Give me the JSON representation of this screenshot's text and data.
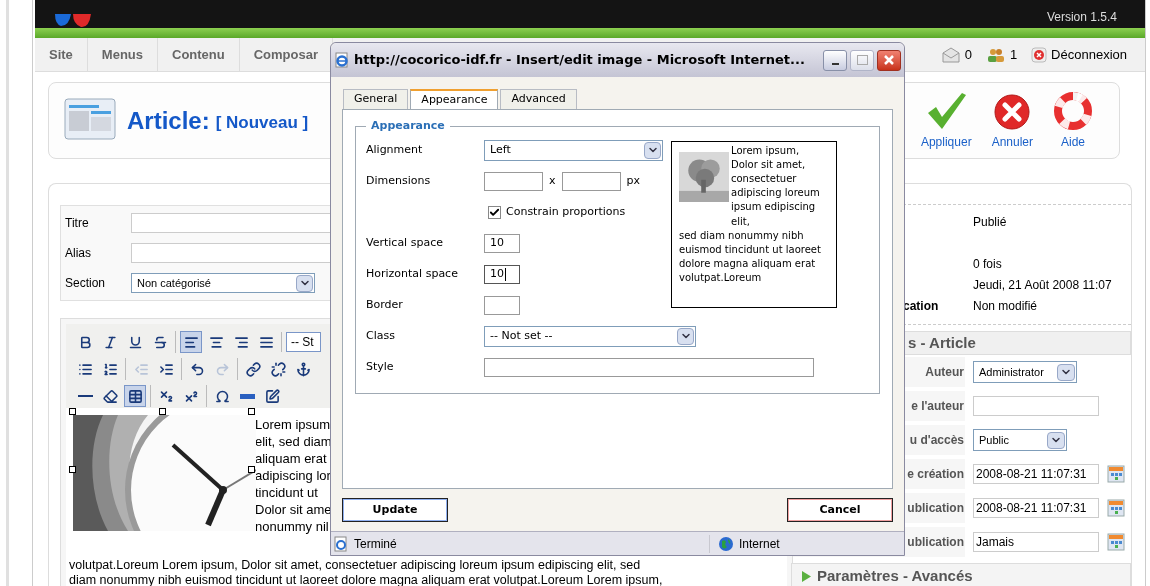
{
  "header": {
    "version": "Version 1.5.4"
  },
  "menu": {
    "items": [
      {
        "label": "Site"
      },
      {
        "label": "Menus"
      },
      {
        "label": "Contenu"
      },
      {
        "label": "Composar"
      }
    ],
    "status": [
      {
        "kind": "messages",
        "label": "0"
      },
      {
        "kind": "users",
        "label": "1"
      },
      {
        "kind": "logout",
        "label": "Déconnexion"
      }
    ]
  },
  "toolbar": {
    "title": "Article:",
    "subtitle": "[ Nouveau ]",
    "buttons": [
      {
        "kind": "apply",
        "label": "Appliquer"
      },
      {
        "kind": "cancel",
        "label": "Annuler"
      },
      {
        "kind": "help",
        "label": "Aide"
      }
    ]
  },
  "form": {
    "fields": [
      {
        "kind": "text",
        "label": "Titre"
      },
      {
        "kind": "text",
        "label": "Alias"
      },
      {
        "kind": "select",
        "label": "Section",
        "value": "Non catégorisé"
      }
    ]
  },
  "editor": {
    "toolbar": [
      [
        [
          {
            "kind": "bold",
            "selected": false,
            "disabled": false
          },
          {
            "kind": "italic",
            "selected": false,
            "disabled": false
          },
          {
            "kind": "underline",
            "selected": false,
            "disabled": false
          },
          {
            "kind": "strike",
            "selected": false,
            "disabled": false
          }
        ],
        [
          {
            "kind": "align-left",
            "selected": true,
            "disabled": false
          },
          {
            "kind": "align-center",
            "selected": false,
            "disabled": false
          },
          {
            "kind": "align-right",
            "selected": false,
            "disabled": false
          },
          {
            "kind": "justify",
            "selected": false,
            "disabled": false
          }
        ],
        [
          {
            "kind": "style-select",
            "label": "-- St"
          }
        ]
      ],
      [
        [
          {
            "kind": "bullets",
            "selected": false,
            "disabled": false
          },
          {
            "kind": "numbers",
            "selected": false,
            "disabled": false
          }
        ],
        [
          {
            "kind": "outdent",
            "selected": false,
            "disabled": true
          },
          {
            "kind": "indent",
            "selected": false,
            "disabled": false
          }
        ],
        [
          {
            "kind": "undo",
            "selected": false,
            "disabled": false
          },
          {
            "kind": "redo",
            "selected": false,
            "disabled": true
          }
        ],
        [
          {
            "kind": "link",
            "selected": false,
            "disabled": false
          },
          {
            "kind": "unlink",
            "selected": false,
            "disabled": false
          },
          {
            "kind": "anchor",
            "selected": false,
            "disabled": false
          }
        ]
      ],
      [
        [
          {
            "kind": "rule",
            "selected": false,
            "disabled": false
          },
          {
            "kind": "eraser",
            "selected": false,
            "disabled": false
          },
          {
            "kind": "table",
            "selected": true,
            "disabled": false
          }
        ],
        [
          {
            "kind": "subscript",
            "selected": false,
            "disabled": false
          },
          {
            "kind": "superscript",
            "selected": false,
            "disabled": false
          }
        ],
        [
          {
            "kind": "omega",
            "selected": false,
            "disabled": false
          },
          {
            "kind": "hr",
            "selected": false,
            "disabled": false
          },
          {
            "kind": "edit",
            "selected": false,
            "disabled": false
          }
        ]
      ]
    ],
    "side_lines": [
      "Lorem ipsum",
      "elit, sed diam",
      "aliquam erat",
      "adipiscing lor",
      "tincidunt ut",
      "Dolor sit ame",
      "nonummy nil"
    ],
    "body_lines": [
      "volutpat.Loreum Lorem ipsum, Dolor sit amet, consectetuer adipiscing loreum ipsum edipiscing elit, sed",
      "diam nonummy nibh euismod tincidunt ut laoreet dolore magna aliquam erat volutpat.Loreum Lorem ipsum,"
    ]
  },
  "details": {
    "rows": [
      {
        "value": "Publié"
      },
      {
        "value": "0 fois"
      },
      {
        "value": "Jeudi, 21 Août 2008 11:07"
      },
      {
        "label": "cation",
        "value": "Non modifié"
      }
    ]
  },
  "params": {
    "title": "s - Article",
    "rows": [
      {
        "kind": "select",
        "label": "Auteur",
        "value": "Administrator"
      },
      {
        "kind": "text",
        "label": "e l'auteur"
      },
      {
        "kind": "select",
        "label": "u d'accès",
        "value": "Public"
      },
      {
        "kind": "date",
        "label": "e création",
        "value": "2008-08-21 11:07:31"
      },
      {
        "kind": "date",
        "label": "ublication",
        "value": "2008-08-21 11:07:31"
      },
      {
        "kind": "date",
        "label": "ublication",
        "value": "Jamais"
      }
    ]
  },
  "advanced": {
    "title": "Paramètres - Avancés",
    "expanded": false
  },
  "dialog": {
    "title": "http://cocorico-idf.fr - Insert/edit image - Microsoft Internet...",
    "tabs": [
      {
        "label": "General",
        "selected": false
      },
      {
        "label": "Appearance",
        "selected": true
      },
      {
        "label": "Advanced",
        "selected": false
      }
    ],
    "legend": "Appearance",
    "rows": [
      {
        "kind": "select",
        "label": "Alignment",
        "value": "Left"
      },
      {
        "kind": "dimensions",
        "label": "Dimensions",
        "separator": "x",
        "unit": "px"
      },
      {
        "kind": "checkbox",
        "label": "Constrain proportions",
        "checked": true
      },
      {
        "kind": "text",
        "label": "Vertical space",
        "value": "10",
        "focused": false
      },
      {
        "kind": "text",
        "label": "Horizontal space",
        "value": "10",
        "focused": true
      },
      {
        "kind": "text",
        "label": "Border",
        "focused": false
      }
    ],
    "lower_rows": [
      {
        "kind": "select",
        "label": "Class",
        "value": "-- Not set --"
      },
      {
        "kind": "wide-text",
        "label": "Style"
      }
    ],
    "preview": {
      "beside": "Lorem ipsum, Dolor sit amet, consectetuer adipiscing loreum ipsum edipiscing elit,",
      "below": "sed diam nonummy nibh euismod tincidunt ut laoreet dolore magna aliquam erat volutpat.Loreum"
    },
    "buttons": [
      {
        "kind": "primary",
        "label": "Update"
      },
      {
        "kind": "cancel",
        "label": "Cancel"
      }
    ],
    "status": [
      {
        "kind": "page",
        "label": "Terminé"
      },
      {
        "kind": "zone",
        "label": "Internet"
      }
    ]
  }
}
